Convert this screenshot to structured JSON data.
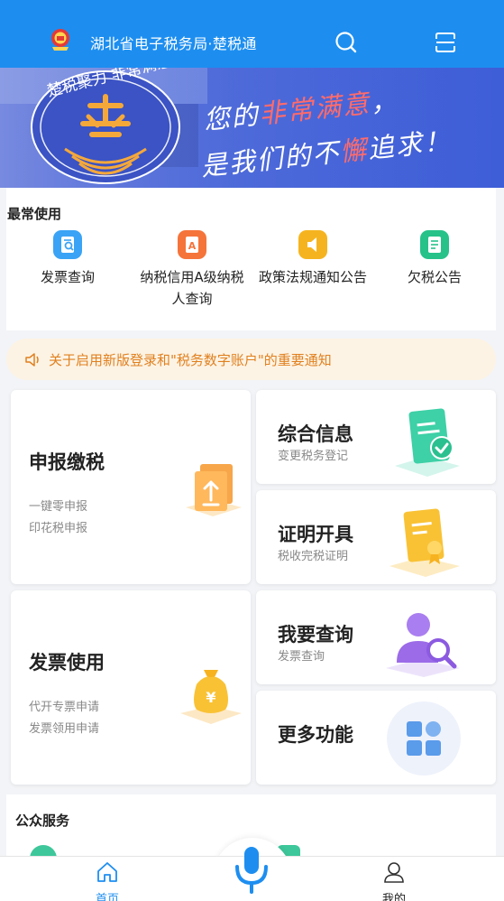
{
  "header": {
    "title": "湖北省电子税务局·楚税通",
    "icons": [
      "emblem-icon",
      "search-icon",
      "scan-icon"
    ],
    "background": "#1d8ef0"
  },
  "banner": {
    "badge_text": "楚税聚力 非常满意",
    "slogan_line1_prefix": "您的",
    "slogan_line1_highlight": "非常满意",
    "slogan_line1_suffix": "，",
    "slogan_line2_prefix": "是我们的不",
    "slogan_line2_highlight": "懈",
    "slogan_line2_suffix": "追求！"
  },
  "frequent": {
    "label": "最常使用",
    "items": [
      {
        "label": "发票查询",
        "icon": "invoice-search-icon",
        "color": "#3aa3f5"
      },
      {
        "label": "纳税信用A级纳税人查询",
        "icon": "credit-rating-icon",
        "color": "#f5743a"
      },
      {
        "label": "政策法规通知公告",
        "icon": "policy-notice-icon",
        "color": "#f5b41f"
      },
      {
        "label": "欠税公告",
        "icon": "tax-arrears-icon",
        "color": "#26c28a"
      }
    ]
  },
  "notice": {
    "text": "关于启用新版登录和\"税务数字账户\"的重要通知",
    "icon": "speaker-icon"
  },
  "cards": {
    "declare": {
      "title": "申报缴税",
      "sub1": "一键零申报",
      "sub2": "印花税申报"
    },
    "info": {
      "title": "综合信息",
      "sub": "变更税务登记"
    },
    "cert": {
      "title": "证明开具",
      "sub": "税收完税证明"
    },
    "invoice": {
      "title": "发票使用",
      "sub1": "代开专票申请",
      "sub2": "发票领用申请"
    },
    "query": {
      "title": "我要查询",
      "sub": "发票查询"
    },
    "more": {
      "title": "更多功能"
    }
  },
  "public": {
    "label": "公众服务"
  },
  "tabbar": {
    "home": "首页",
    "mine": "我的",
    "accent": "#1d8ef0"
  }
}
